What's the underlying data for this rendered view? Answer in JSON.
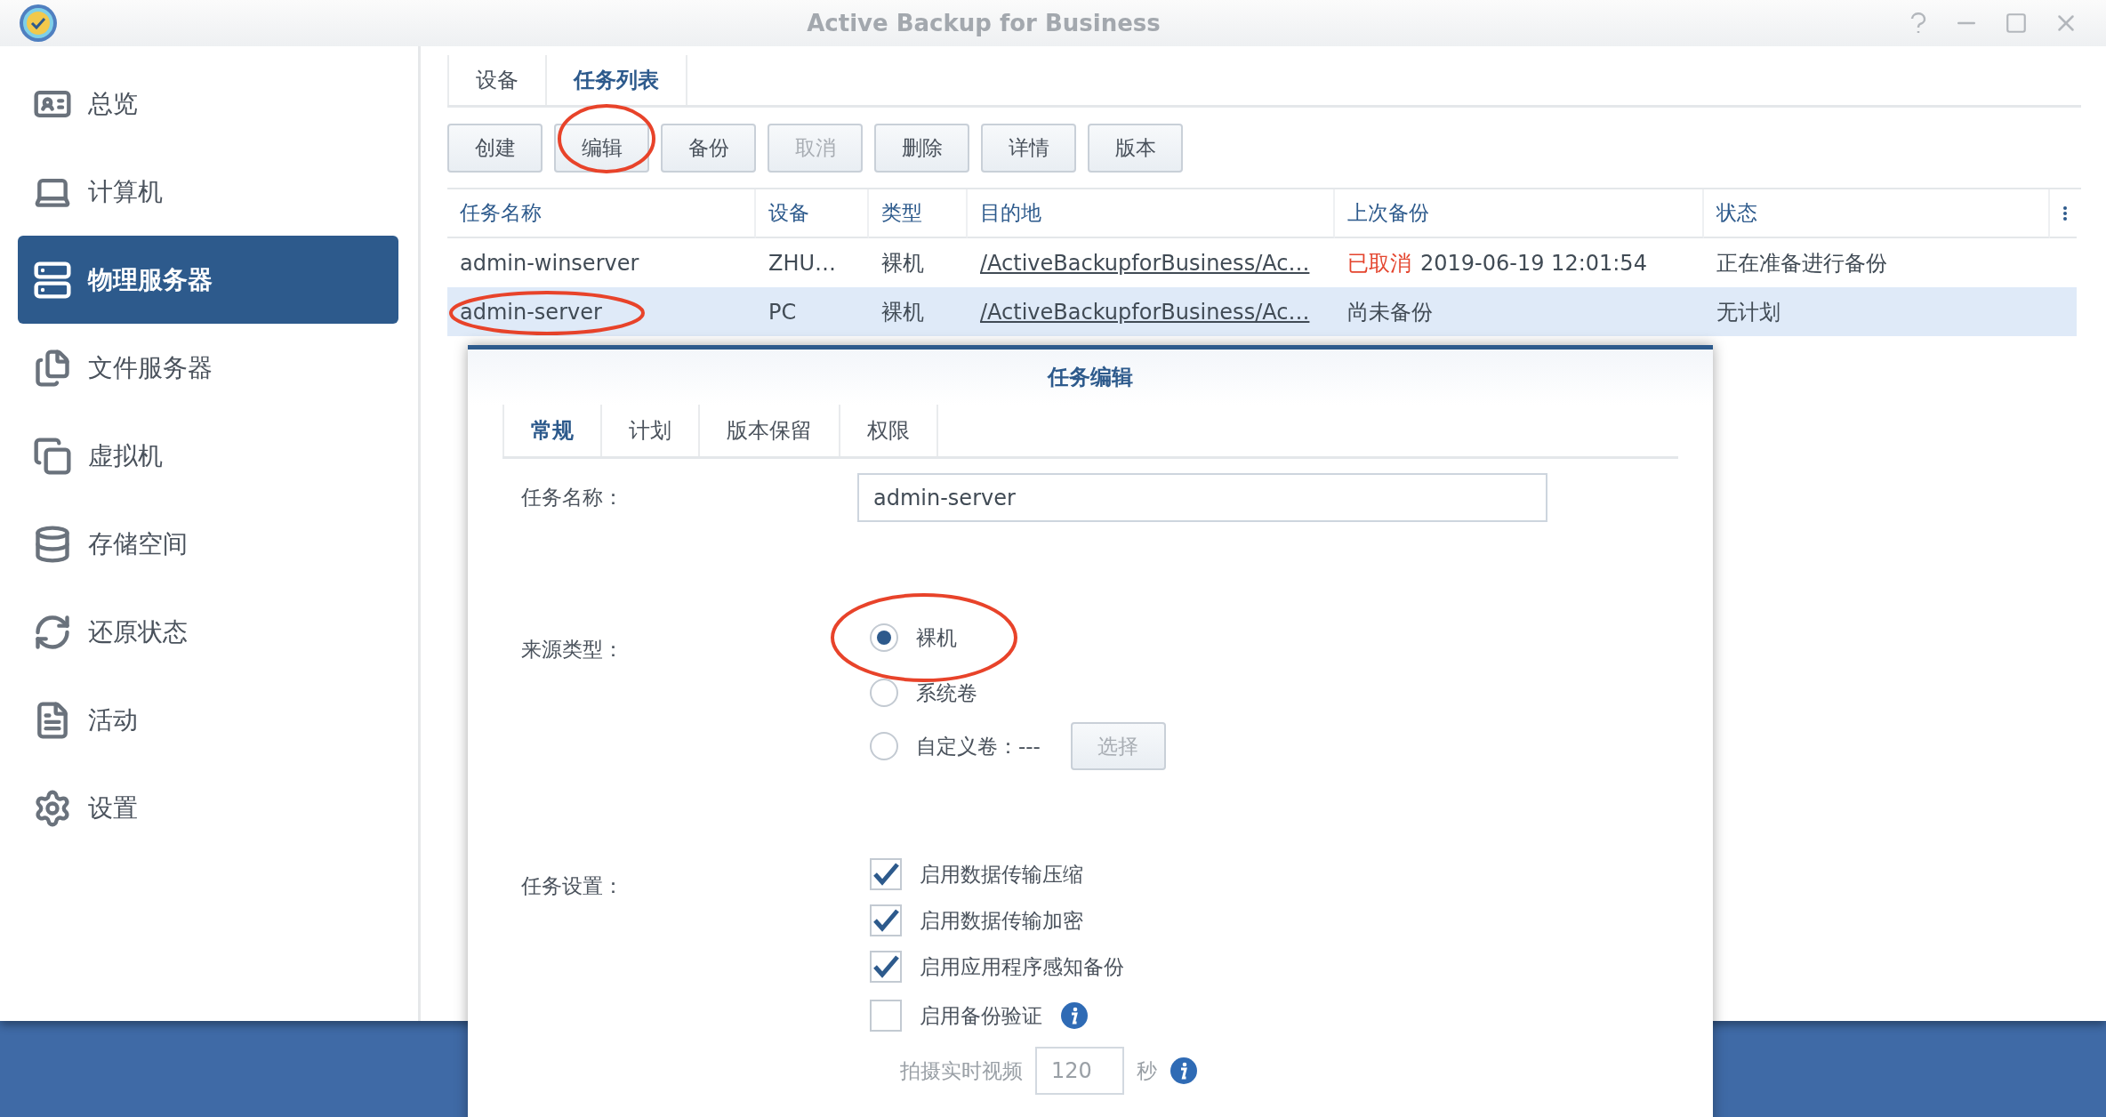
{
  "window": {
    "title": "Active Backup for Business"
  },
  "sidebar": {
    "items": [
      {
        "label": "总览",
        "selected": false
      },
      {
        "label": "计算机",
        "selected": false
      },
      {
        "label": "物理服务器",
        "selected": true
      },
      {
        "label": "文件服务器",
        "selected": false
      },
      {
        "label": "虚拟机",
        "selected": false
      },
      {
        "label": "存储空间",
        "selected": false
      },
      {
        "label": "还原状态",
        "selected": false
      },
      {
        "label": "活动",
        "selected": false
      },
      {
        "label": "设置",
        "selected": false
      }
    ]
  },
  "tabs": [
    {
      "label": "设备",
      "selected": false
    },
    {
      "label": "任务列表",
      "selected": true
    }
  ],
  "toolbar": {
    "buttons": [
      {
        "label": "创建",
        "disabled": false,
        "circled": false
      },
      {
        "label": "编辑",
        "disabled": false,
        "circled": true
      },
      {
        "label": "备份",
        "disabled": false,
        "circled": false
      },
      {
        "label": "取消",
        "disabled": true,
        "circled": false
      },
      {
        "label": "删除",
        "disabled": false,
        "circled": false
      },
      {
        "label": "详情",
        "disabled": false,
        "circled": false
      },
      {
        "label": "版本",
        "disabled": false,
        "circled": false
      }
    ]
  },
  "table": {
    "columns": [
      "任务名称",
      "设备",
      "类型",
      "目的地",
      "上次备份",
      "状态"
    ],
    "rows": [
      {
        "selected": false,
        "circled": false,
        "name": "admin-winserver",
        "device": "ZHU…",
        "type": "裸机",
        "destination": "/ActiveBackupforBusiness/Ac…",
        "cancelled_label": "已取消",
        "last_backup": "2019-06-19 12:01:54",
        "status": "正在准备进行备份"
      },
      {
        "selected": true,
        "circled": true,
        "name": "admin-server",
        "device": "PC",
        "type": "裸机",
        "destination": "/ActiveBackupforBusiness/Ac…",
        "last_backup": "尚未备份",
        "status": "无计划"
      }
    ]
  },
  "dialog": {
    "title": "任务编辑",
    "tabs": [
      {
        "label": "常规",
        "selected": true
      },
      {
        "label": "计划",
        "selected": false
      },
      {
        "label": "版本保留",
        "selected": false
      },
      {
        "label": "权限",
        "selected": false
      }
    ],
    "task_name": {
      "label": "任务名称：",
      "value": "admin-server"
    },
    "source_type": {
      "label": "来源类型：",
      "options": [
        {
          "label": "裸机",
          "selected": true,
          "circled": true
        },
        {
          "label": "系统卷",
          "selected": false,
          "circled": false
        },
        {
          "label": "自定义卷：---",
          "selected": false,
          "circled": false,
          "button": {
            "label": "选择",
            "disabled": true
          }
        }
      ]
    },
    "task_settings": {
      "label": "任务设置：",
      "options": [
        {
          "label": "启用数据传输压缩",
          "checked": true,
          "info": false
        },
        {
          "label": "启用数据传输加密",
          "checked": true,
          "info": false
        },
        {
          "label": "启用应用程序感知备份",
          "checked": true,
          "info": false
        },
        {
          "label": "启用备份验证",
          "checked": false,
          "info": true
        }
      ],
      "video": {
        "label": "拍摄实时视频",
        "value": "120",
        "unit": "秒",
        "disabled": true,
        "info": true
      }
    }
  }
}
